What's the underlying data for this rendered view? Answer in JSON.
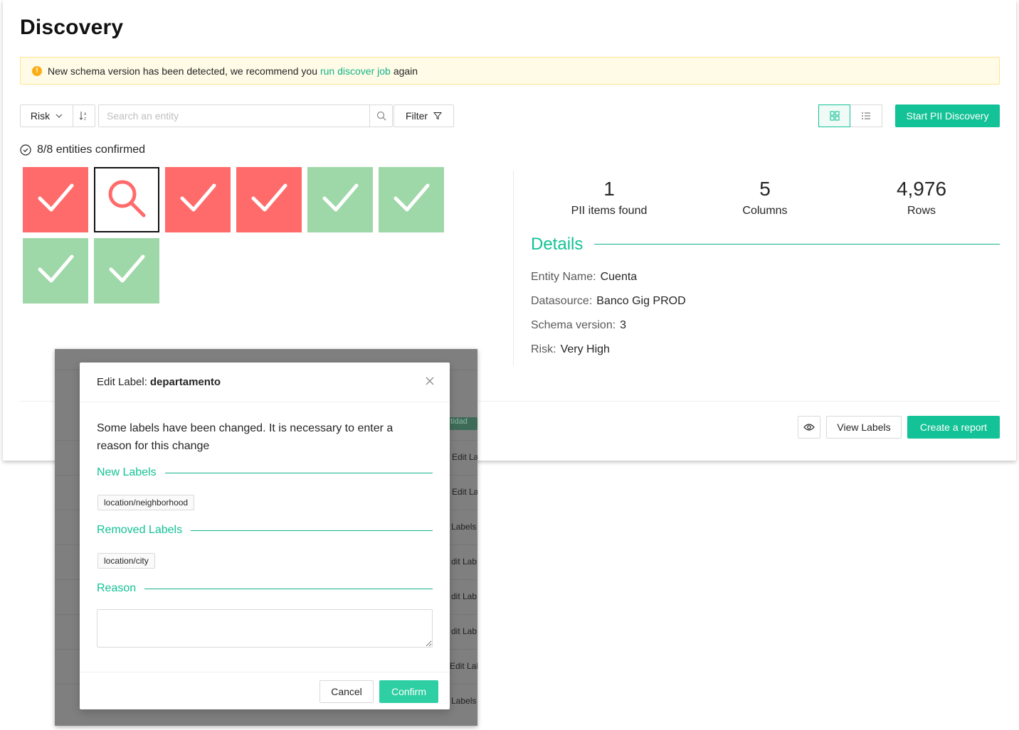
{
  "page": {
    "title": "Discovery"
  },
  "alert": {
    "text_before": "New schema version has been detected, we recommend you",
    "link_text": "run discover job",
    "text_after": "again",
    "icon": "exclamation-icon"
  },
  "toolbar": {
    "sort_value": "Risk",
    "search_placeholder": "Search an entity",
    "filter_label": "Filter",
    "start_button": "Start PII Discovery"
  },
  "entities": {
    "confirmed_text": "8/8 entities confirmed",
    "tiles": [
      {
        "risk": "high",
        "state": "confirmed"
      },
      {
        "risk": "high",
        "state": "selected"
      },
      {
        "risk": "high",
        "state": "confirmed"
      },
      {
        "risk": "high",
        "state": "confirmed"
      },
      {
        "risk": "low",
        "state": "confirmed"
      },
      {
        "risk": "low",
        "state": "confirmed"
      },
      {
        "risk": "low",
        "state": "confirmed"
      },
      {
        "risk": "low",
        "state": "confirmed"
      }
    ],
    "colors": {
      "high": "#ff6b6b",
      "low": "#9fd8a8"
    }
  },
  "stats": [
    {
      "value": "1",
      "label": "PII items found"
    },
    {
      "value": "5",
      "label": "Columns"
    },
    {
      "value": "4,976",
      "label": "Rows"
    }
  ],
  "details": {
    "title": "Details",
    "rows": [
      {
        "label": "Entity Name:",
        "value": "Cuenta"
      },
      {
        "label": "Datasource:",
        "value": "Banco Gig PROD"
      },
      {
        "label": "Schema version:",
        "value": "3"
      },
      {
        "label": "Risk:",
        "value": "Very High"
      }
    ]
  },
  "actions": {
    "view_labels": "View Labels",
    "create_report": "Create a report"
  },
  "background_table": {
    "tag": "tidad",
    "links": [
      "Edit La",
      "Edit La",
      "Labels",
      "dit Lab",
      "dit Lab",
      "dit Lab",
      "Edit Lab",
      "Labels"
    ]
  },
  "modal": {
    "title_prefix": "Edit Label:",
    "title_field": "departamento",
    "message": "Some labels have been changed. It is necessary to enter a reason for this change",
    "new_labels_title": "New Labels",
    "new_labels": [
      "location/neighborhood"
    ],
    "removed_labels_title": "Removed Labels",
    "removed_labels": [
      "location/city"
    ],
    "reason_title": "Reason",
    "reason_value": "",
    "cancel": "Cancel",
    "confirm": "Confirm"
  },
  "colors": {
    "accent": "#13c296",
    "warning_bg": "#fffbe6",
    "warning_icon": "#faad14"
  }
}
